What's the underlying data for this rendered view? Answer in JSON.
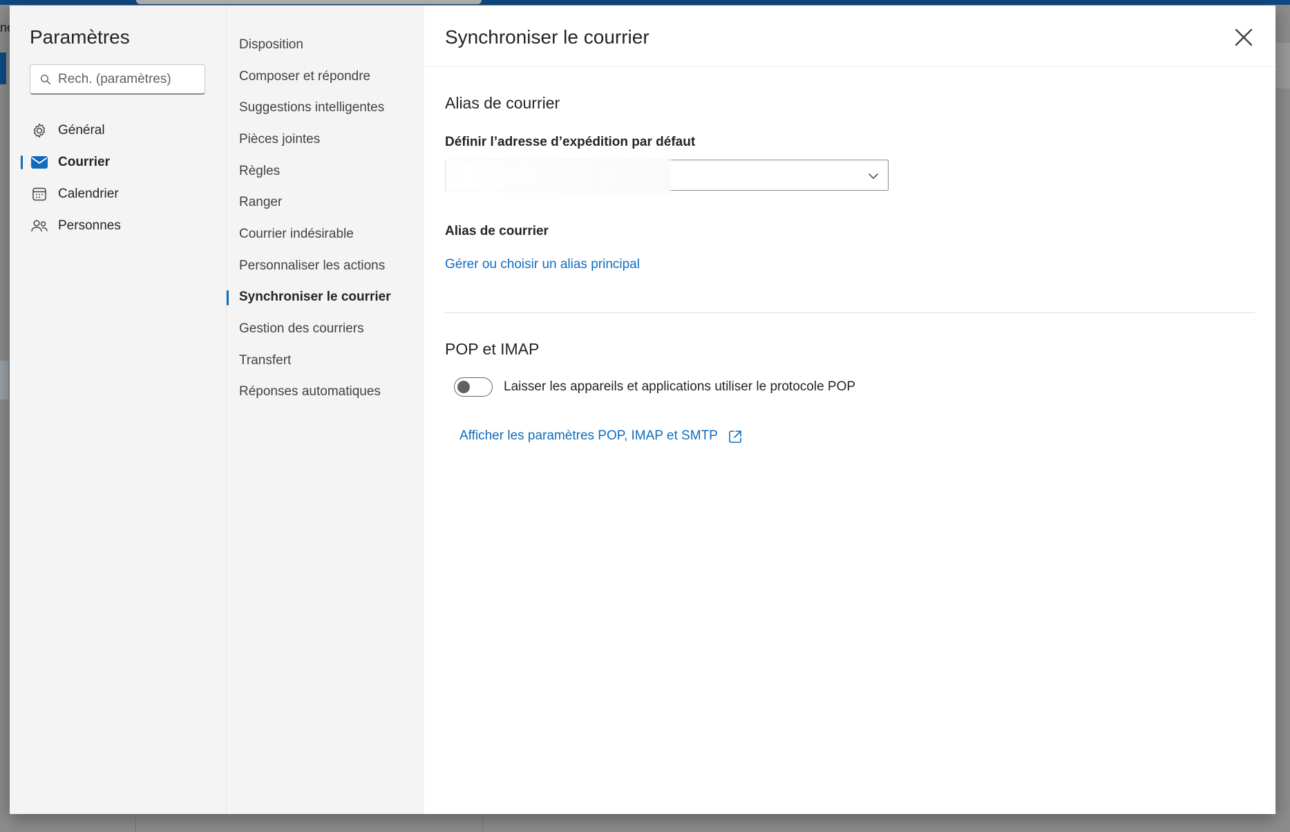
{
  "background": {
    "left_fragment": "ne"
  },
  "settings": {
    "title": "Paramètres",
    "search_placeholder": "Rech. (paramètres)",
    "categories": [
      {
        "label": "Général",
        "icon": "gear-icon",
        "active": false
      },
      {
        "label": "Courrier",
        "icon": "mail-icon",
        "active": true
      },
      {
        "label": "Calendrier",
        "icon": "calendar-icon",
        "active": false
      },
      {
        "label": "Personnes",
        "icon": "people-icon",
        "active": false
      }
    ]
  },
  "mail_menu": {
    "items": [
      {
        "label": "Disposition",
        "active": false
      },
      {
        "label": "Composer et répondre",
        "active": false
      },
      {
        "label": "Suggestions intelligentes",
        "active": false
      },
      {
        "label": "Pièces jointes",
        "active": false
      },
      {
        "label": "Règles",
        "active": false
      },
      {
        "label": "Ranger",
        "active": false
      },
      {
        "label": "Courrier indésirable",
        "active": false
      },
      {
        "label": "Personnaliser les actions",
        "active": false
      },
      {
        "label": "Synchroniser le courrier",
        "active": true
      },
      {
        "label": "Gestion des courriers",
        "active": false
      },
      {
        "label": "Transfert",
        "active": false
      },
      {
        "label": "Réponses automatiques",
        "active": false
      }
    ]
  },
  "content": {
    "title": "Synchroniser le courrier",
    "alias_section_title": "Alias de courrier",
    "default_address_label": "Définir l’adresse d’expédition par défaut",
    "default_address_value": "",
    "alias_label": "Alias de courrier",
    "manage_alias_link": "Gérer ou choisir un alias principal",
    "pop_section_title": "POP et IMAP",
    "pop_toggle_label": "Laisser les appareils et applications utiliser le protocole POP",
    "pop_toggle_on": false,
    "pop_settings_link": "Afficher les paramètres POP, IMAP et SMTP"
  },
  "colors": {
    "accent": "#0f6cbd",
    "nav_background": "#f4f4f4",
    "app_bar": "#0f4a85"
  }
}
